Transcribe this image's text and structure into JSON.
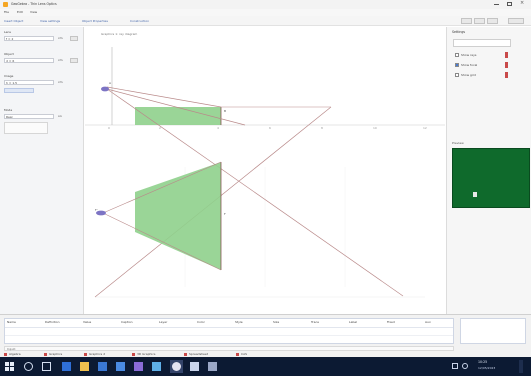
{
  "window": {
    "title": "GeoGebra - Thin Lens Optics",
    "controls": [
      "minimize-icon",
      "maximize-icon",
      "close-icon"
    ]
  },
  "menubar": {
    "items": [
      "File",
      "Edit",
      "View"
    ]
  },
  "toolbar": {
    "labels": [
      "Insert Object",
      "View settings",
      "Object Properties",
      "Construction"
    ]
  },
  "left_panel": {
    "sections": [
      {
        "heading": "Lens",
        "value": "f = 2",
        "suffix": "cm"
      },
      {
        "heading": "Object",
        "value": "d = 6",
        "suffix": "cm"
      },
      {
        "heading": "Image",
        "value": "h = 1.5",
        "suffix": "cm"
      },
      {
        "heading": "Mode",
        "value": "Real",
        "suffix": "on"
      }
    ]
  },
  "canvas": {
    "top_label": "Graphics 1: ray diagram",
    "axis_ticks": [
      "0",
      "2",
      "4",
      "6",
      "8",
      "10",
      "12"
    ],
    "point_labels": [
      "A",
      "B",
      "F",
      "F'"
    ]
  },
  "right_panel": {
    "title": "Settings",
    "items": [
      "Show rays",
      "Show focal",
      "Show grid"
    ],
    "preview_label": "Preview"
  },
  "status": {
    "columns": [
      "Name",
      "Definition",
      "Value",
      "Caption",
      "Layer",
      "Color",
      "Style",
      "Size",
      "Trace",
      "Label",
      "Fixed",
      "Aux"
    ],
    "input_bar": "Input:",
    "tags": [
      "Algebra",
      "Graphics",
      "Graphics 2",
      "3D Graphics",
      "Spreadsheet",
      "CAS"
    ]
  },
  "taskbar": {
    "clock_time": "10:25",
    "clock_date": "12/05/2023"
  },
  "colors": {
    "taskbar": "#0c1a33",
    "lens_fill": "#8fd08c",
    "ray_line": "#b98a8a",
    "preview_bg": "#0f6a2c",
    "accent": "#4a7bd0"
  }
}
